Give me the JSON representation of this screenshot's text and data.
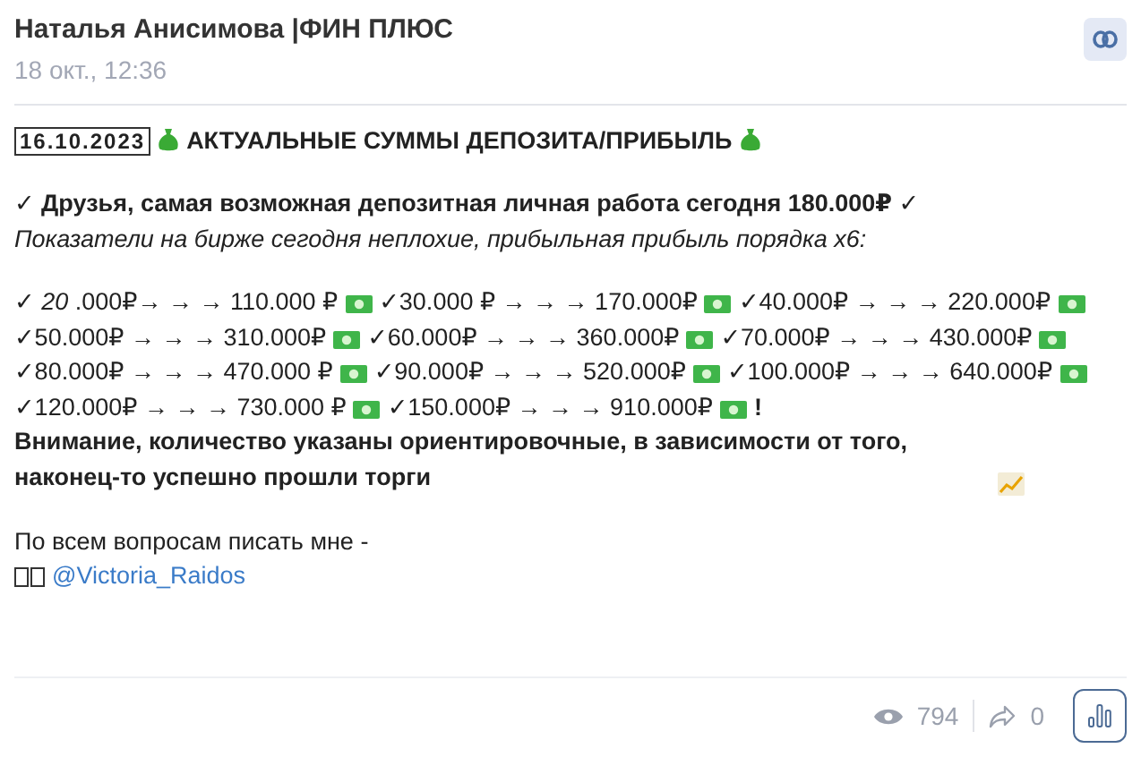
{
  "header": {
    "author": "Наталья Анисимова |ФИН ПЛЮС",
    "date": "18 окт., 12:36"
  },
  "post": {
    "date_keycaps": "16.10.2023",
    "headline": "АКТУАЛЬНЫЕ СУММЫ ДЕПОЗИТА/ПРИБЫЛЬ",
    "intro": "✓ Друзья, самая возможная депозитная личная работа сегодня 180.000₽ ✓",
    "subtitle": "Показатели на бирже сегодня неплохие, прибыльная прибыль порядка х6:",
    "earnings": [
      "✓ *20* .000₽→ → → 110.000 ₽",
      "✓30.000 ₽ → → → 170.000₽",
      "✓40.000₽ → → → 220.000₽",
      "✓50.000₽ → → → 310.000₽",
      "✓60.000₽ → → → 360.000₽",
      "✓70.000₽ → → → 430.000₽",
      "✓80.000₽ → → → 470.000 ₽",
      "✓90.000₽ → → → 520.000₽",
      "✓100.000₽ → → → 640.000₽",
      "✓120.000₽ → → → 730.000 ₽",
      "✓150.000₽ → → → 910.000₽"
    ],
    "earnings_end": "!",
    "notice": "Внимание, количество указаны ориентировочные, в зависимости от того, наконец-то успешно прошли торги",
    "contact": "По всем вопросам писать мне -",
    "handle": "@Victoria_Raidos"
  },
  "footer": {
    "views": "794",
    "shares": "0"
  }
}
